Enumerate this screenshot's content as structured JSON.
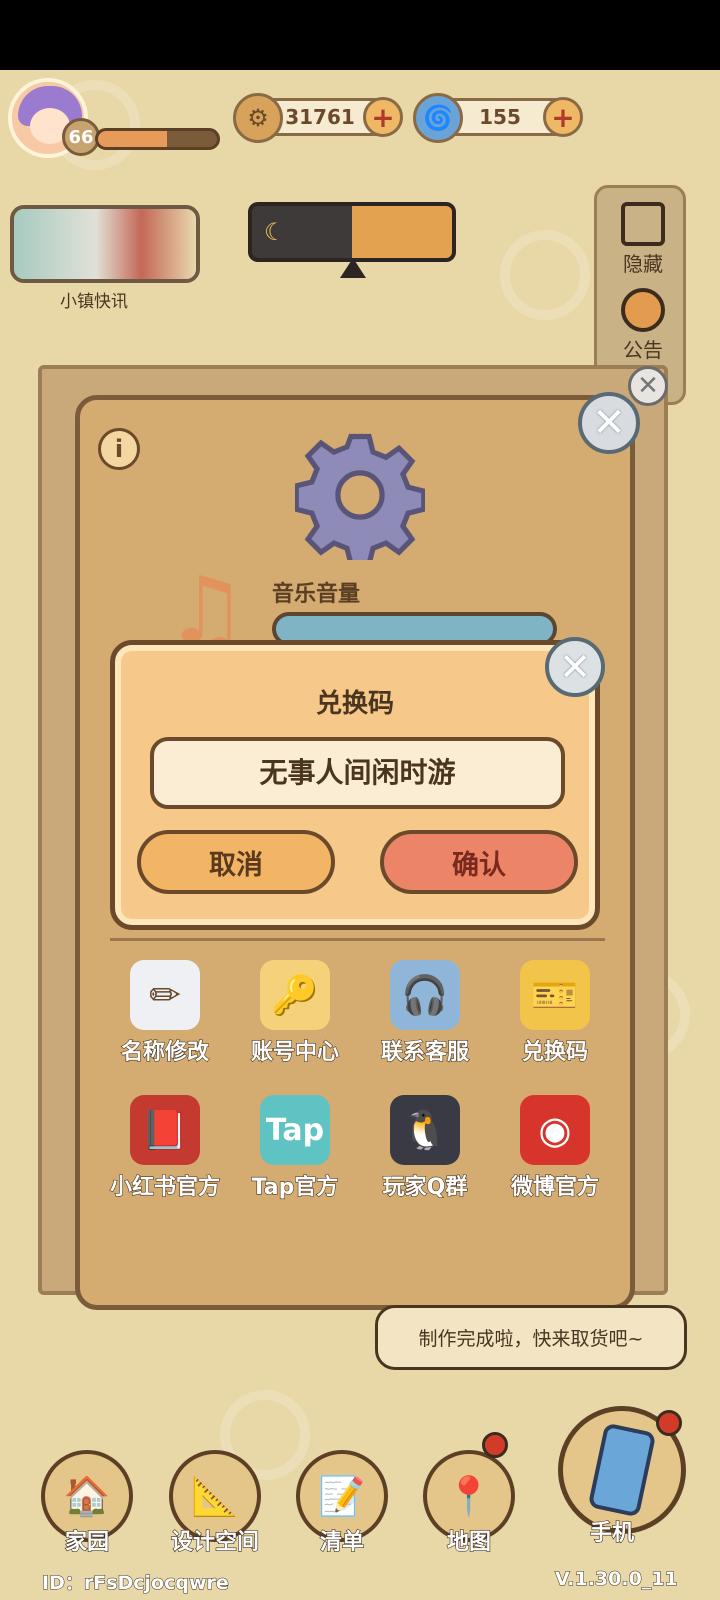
{
  "hud": {
    "level": "66",
    "xp_fraction": 0.58,
    "coins": "31761",
    "gems": "155"
  },
  "side": {
    "hide_label": "隐藏",
    "notice_label": "公告"
  },
  "news": {
    "label": "小镇快讯"
  },
  "settings": {
    "music_label": "音乐音量",
    "grid": [
      {
        "label": "名称修改",
        "icon": "pencil-icon"
      },
      {
        "label": "账号中心",
        "icon": "key-icon"
      },
      {
        "label": "联系客服",
        "icon": "headset-icon"
      },
      {
        "label": "兑换码",
        "icon": "ticket-icon"
      },
      {
        "label": "小红书官方",
        "icon": "book-icon"
      },
      {
        "label": "Tap官方",
        "icon": "tap-icon"
      },
      {
        "label": "玩家Q群",
        "icon": "penguin-icon"
      },
      {
        "label": "微博官方",
        "icon": "weibo-icon"
      }
    ]
  },
  "redeem": {
    "title": "兑换码",
    "input_value": "无事人间闲时游",
    "cancel_label": "取消",
    "confirm_label": "确认"
  },
  "bubble": {
    "text": "制作完成啦，快来取货吧~"
  },
  "nav": {
    "items": [
      {
        "label": "家园",
        "icon": "house-icon"
      },
      {
        "label": "设计空间",
        "icon": "design-icon"
      },
      {
        "label": "清单",
        "icon": "list-icon"
      },
      {
        "label": "地图",
        "icon": "map-pin-icon"
      }
    ],
    "phone_label": "手机"
  },
  "footer": {
    "id_text": "ID：rFsDcjocqwre",
    "version": "V.1.30.0_11"
  },
  "colors": {
    "panel": "#d4ac72",
    "dialog": "#f6c98a",
    "cancel": "#f2b565",
    "confirm": "#ec8568",
    "outline": "#6a4a2a"
  }
}
